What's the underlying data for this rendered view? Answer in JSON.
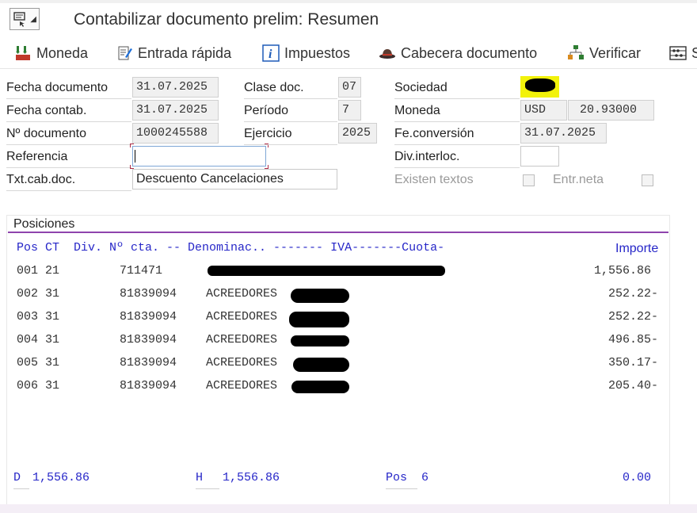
{
  "window": {
    "title": "Contabilizar documento prelim: Resumen"
  },
  "toolbar": {
    "moneda": "Moneda",
    "entrada_rapida": "Entrada rápida",
    "impuestos": "Impuestos",
    "cabecera": "Cabecera documento",
    "verificar": "Verificar",
    "more": "S"
  },
  "header": {
    "fecha_documento": {
      "label": "Fecha documento",
      "value": "31.07.2025"
    },
    "fecha_contab": {
      "label": "Fecha contab.",
      "value": "31.07.2025"
    },
    "num_documento": {
      "label": "Nº documento",
      "value": "1000245588"
    },
    "referencia": {
      "label": "Referencia",
      "value": ""
    },
    "txt_cab_doc": {
      "label": "Txt.cab.doc.",
      "value": "Descuento Cancelaciones"
    },
    "clase_doc": {
      "label": "Clase doc.",
      "value": "07"
    },
    "periodo": {
      "label": "Período",
      "value": "7"
    },
    "ejercicio": {
      "label": "Ejercicio",
      "value": "2025"
    },
    "sociedad": {
      "label": "Sociedad",
      "value": ""
    },
    "moneda": {
      "label": "Moneda",
      "value": "USD",
      "rate": "20.93000"
    },
    "fe_conversion": {
      "label": "Fe.conversión",
      "value": "31.07.2025"
    },
    "div_interloc": {
      "label": "Div.interloc.",
      "value": ""
    },
    "existen_textos": {
      "label": "Existen textos"
    },
    "entr_neta": {
      "label": "Entr.neta"
    }
  },
  "positions": {
    "title": "Posiciones",
    "header_line": "Pos CT  Div. Nº cta. -- Denominac.. ------- IVA-------Cuota-",
    "importe_label": "Importe",
    "rows": [
      {
        "pos": "001",
        "ct": "21",
        "account": "711471",
        "name": "",
        "amount": "1,556.86"
      },
      {
        "pos": "002",
        "ct": "31",
        "account": "81839094",
        "name": "ACREEDORES",
        "amount": "252.22-"
      },
      {
        "pos": "003",
        "ct": "31",
        "account": "81839094",
        "name": "ACREEDORES",
        "amount": "252.22-"
      },
      {
        "pos": "004",
        "ct": "31",
        "account": "81839094",
        "name": "ACREEDORES",
        "amount": "496.85-"
      },
      {
        "pos": "005",
        "ct": "31",
        "account": "81839094",
        "name": "ACREEDORES",
        "amount": "350.17-"
      },
      {
        "pos": "006",
        "ct": "31",
        "account": "81839094",
        "name": "ACREEDORES",
        "amount": "205.40-"
      }
    ]
  },
  "totals": {
    "d_label": "D",
    "d_value": "1,556.86",
    "h_label": "H",
    "h_value": "1,556.86",
    "pos_label": "Pos",
    "pos_value": "6",
    "balance": "0.00"
  },
  "colors": {
    "accent_purple": "#8e44ad",
    "list_blue": "#2626c8",
    "highlight_yellow": "#f2f20a"
  }
}
